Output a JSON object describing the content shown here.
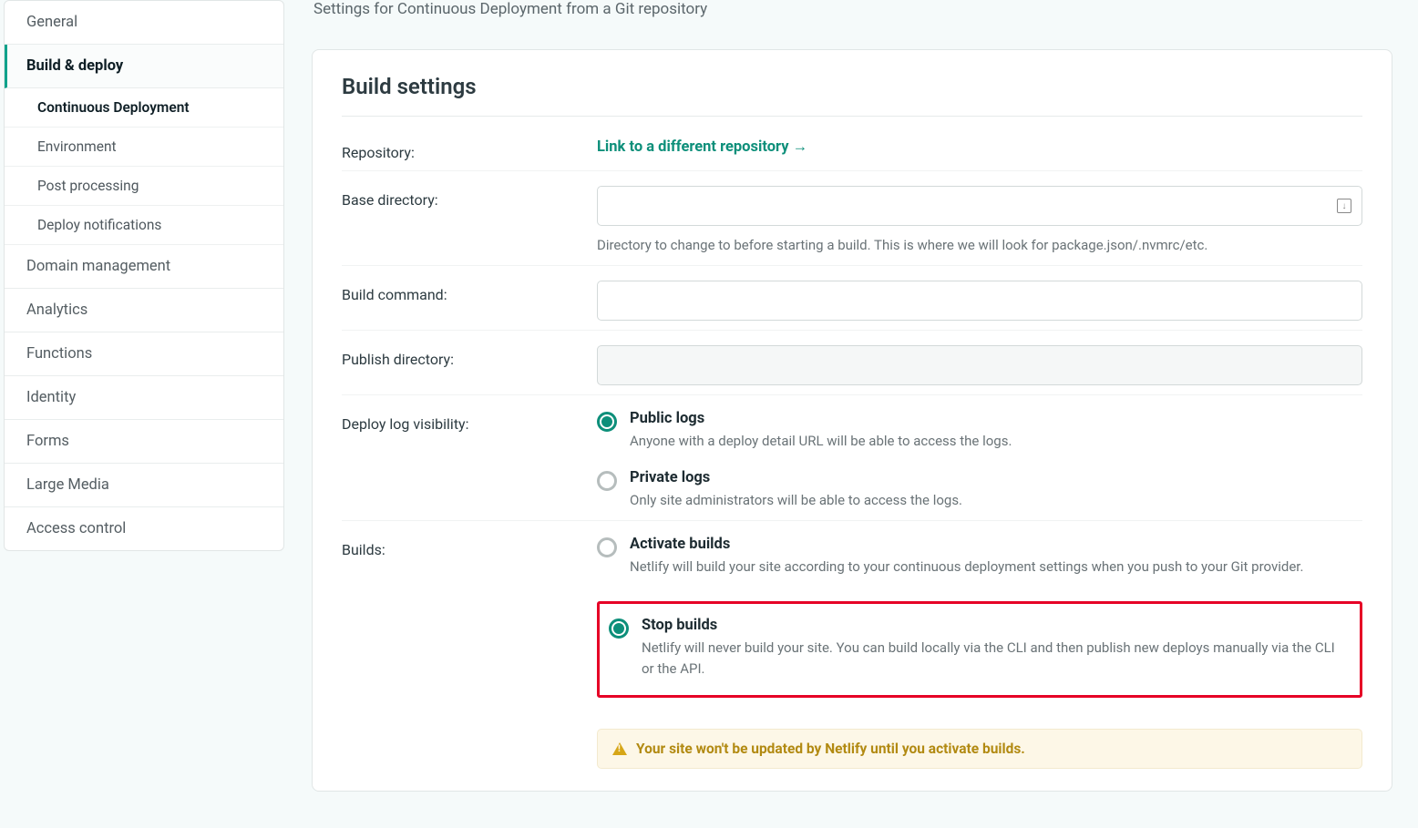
{
  "page": {
    "subtitle": "Settings for Continuous Deployment from a Git repository"
  },
  "sidebar": {
    "items": [
      {
        "label": "General"
      },
      {
        "label": "Build & deploy"
      },
      {
        "label": "Domain management"
      },
      {
        "label": "Analytics"
      },
      {
        "label": "Functions"
      },
      {
        "label": "Identity"
      },
      {
        "label": "Forms"
      },
      {
        "label": "Large Media"
      },
      {
        "label": "Access control"
      }
    ],
    "build_subs": [
      {
        "label": "Continuous Deployment"
      },
      {
        "label": "Environment"
      },
      {
        "label": "Post processing"
      },
      {
        "label": "Deploy notifications"
      }
    ]
  },
  "card": {
    "title": "Build settings",
    "repository_label": "Repository:",
    "repository_link": "Link to a different repository →",
    "base_dir_label": "Base directory:",
    "base_dir_value": "",
    "base_dir_help": "Directory to change to before starting a build. This is where we will look for package.json/.nvmrc/etc.",
    "build_cmd_label": "Build command:",
    "build_cmd_value": "",
    "publish_dir_label": "Publish directory:",
    "publish_dir_value": "",
    "logvis_label": "Deploy log visibility:",
    "logvis": {
      "public_title": "Public logs",
      "public_desc": "Anyone with a deploy detail URL will be able to access the logs.",
      "private_title": "Private logs",
      "private_desc": "Only site administrators will be able to access the logs."
    },
    "builds_label": "Builds:",
    "builds": {
      "activate_title": "Activate builds",
      "activate_desc": "Netlify will build your site according to your continuous deployment settings when you push to your Git provider.",
      "stop_title": "Stop builds",
      "stop_desc": "Netlify will never build your site. You can build locally via the CLI and then publish new deploys manually via the CLI or the API."
    },
    "warning": "Your site won't be updated by Netlify until you activate builds."
  }
}
